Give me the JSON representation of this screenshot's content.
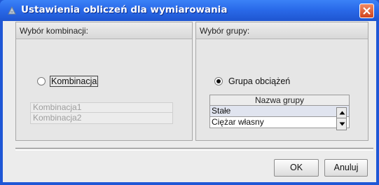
{
  "window": {
    "title": "Ustawienia obliczeń dla wymiarowania",
    "colors": {
      "titlebar": "#2a6ae9",
      "close": "#d0431c",
      "client": "#ececec"
    }
  },
  "left_panel": {
    "header": "Wybór kombinacji:",
    "radio_label": "Kombinacja",
    "radio_checked": false,
    "list_items": [
      "Kombinacja1",
      "Kombinacja2"
    ]
  },
  "right_panel": {
    "header": "Wybór grupy:",
    "radio_label": "Grupa obciążeń",
    "radio_checked": true,
    "table_header": "Nazwa grupy",
    "rows": [
      "Stałe",
      "Ciężar własny"
    ]
  },
  "buttons": {
    "ok": "OK",
    "cancel": "Anuluj"
  },
  "icons": {
    "title": "app-icon",
    "close": "close-icon",
    "scroll_up": "arrow-up-icon",
    "scroll_down": "arrow-down-icon"
  }
}
